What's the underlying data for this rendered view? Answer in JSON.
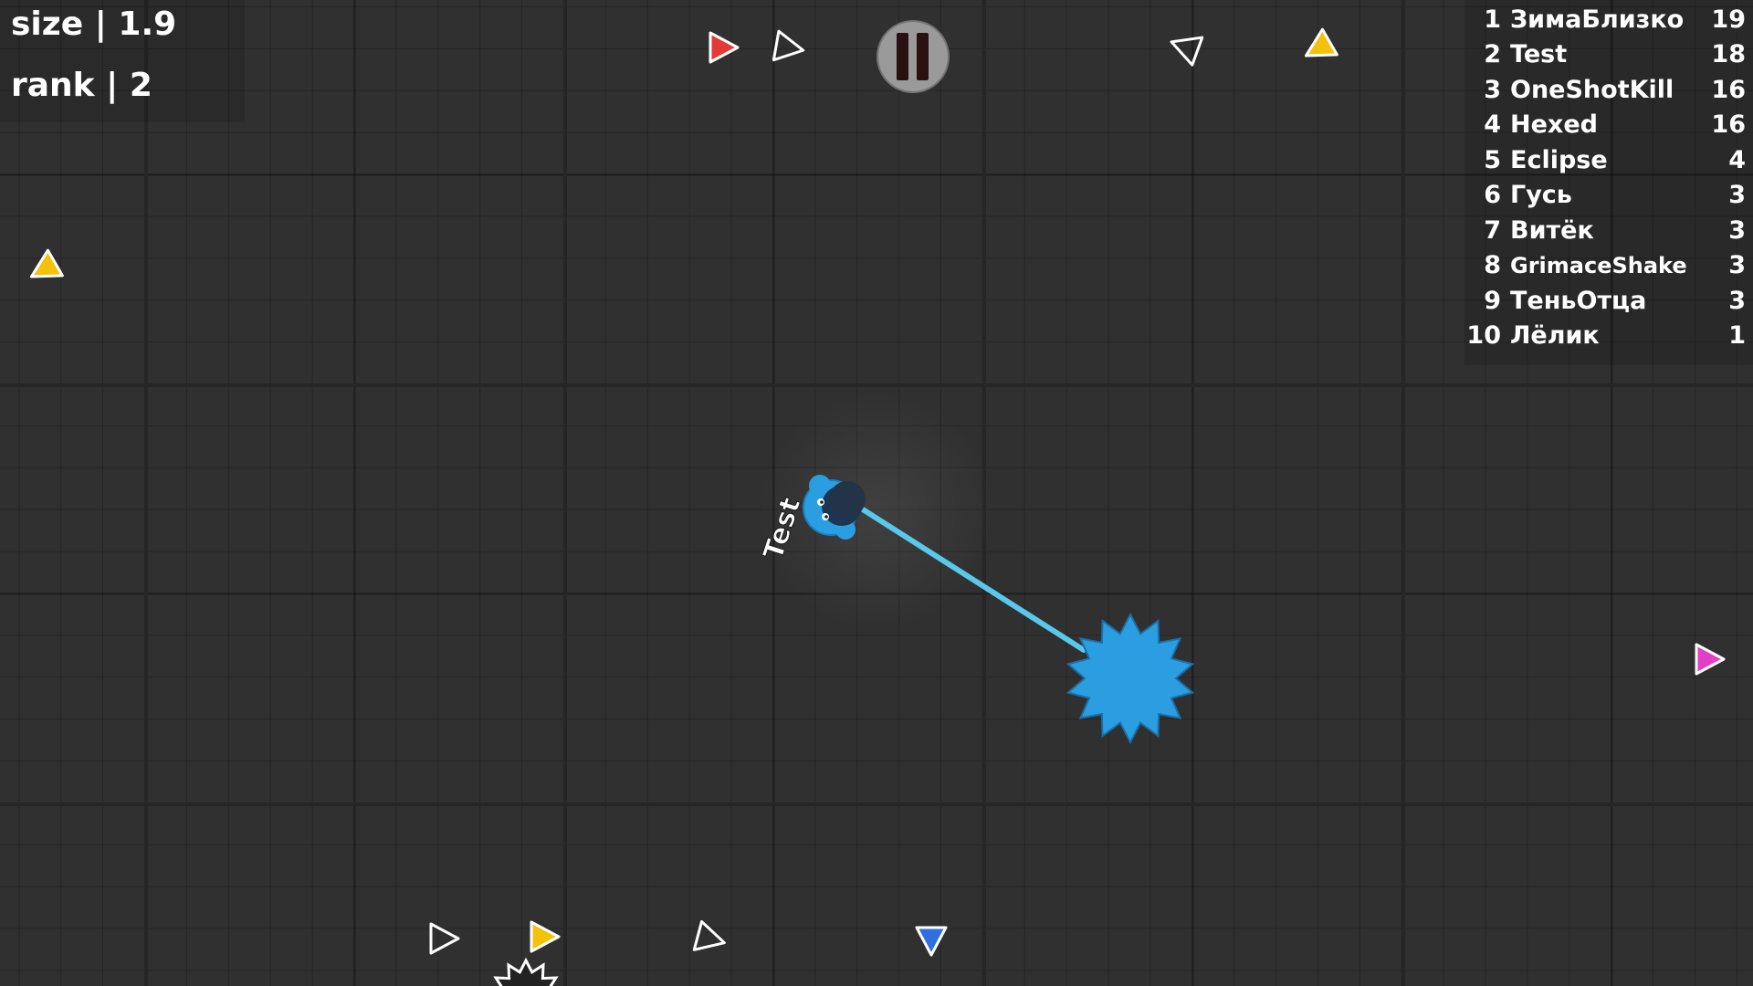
{
  "hud": {
    "size_label": "size",
    "size_value": "1.9",
    "rank_label": "rank",
    "rank_value": "2",
    "separator": "|"
  },
  "player": {
    "name": "Test",
    "color": "#2a9ee0"
  },
  "leaderboard": [
    {
      "rank": "1",
      "name": "ЗимаБлизко",
      "score": "19"
    },
    {
      "rank": "2",
      "name": "Test",
      "score": "18"
    },
    {
      "rank": "3",
      "name": "OneShotKill",
      "score": "16"
    },
    {
      "rank": "4",
      "name": "Hexed",
      "score": "16"
    },
    {
      "rank": "5",
      "name": "Eclipse",
      "score": "4"
    },
    {
      "rank": "6",
      "name": "Гусь",
      "score": "3"
    },
    {
      "rank": "7",
      "name": "Витёк",
      "score": "3"
    },
    {
      "rank": "8",
      "name": "GrimaceShake",
      "score": "3"
    },
    {
      "rank": "9",
      "name": "ТеньОтца",
      "score": "3"
    },
    {
      "rank": "10",
      "name": "Лёлик",
      "score": "1"
    }
  ],
  "pointer_colors": [
    "#e53935",
    "#ffffff",
    "#ffffff",
    "#f4c20d",
    "#f4c20d",
    "#e040c8",
    "#ffffff",
    "#f4c20d",
    "#ffffff",
    "#2f6fe0"
  ],
  "icons": {
    "pause": "pause-icon",
    "pointer": "offscreen-player-arrow-icon",
    "mace": "spiked-mace-icon"
  }
}
